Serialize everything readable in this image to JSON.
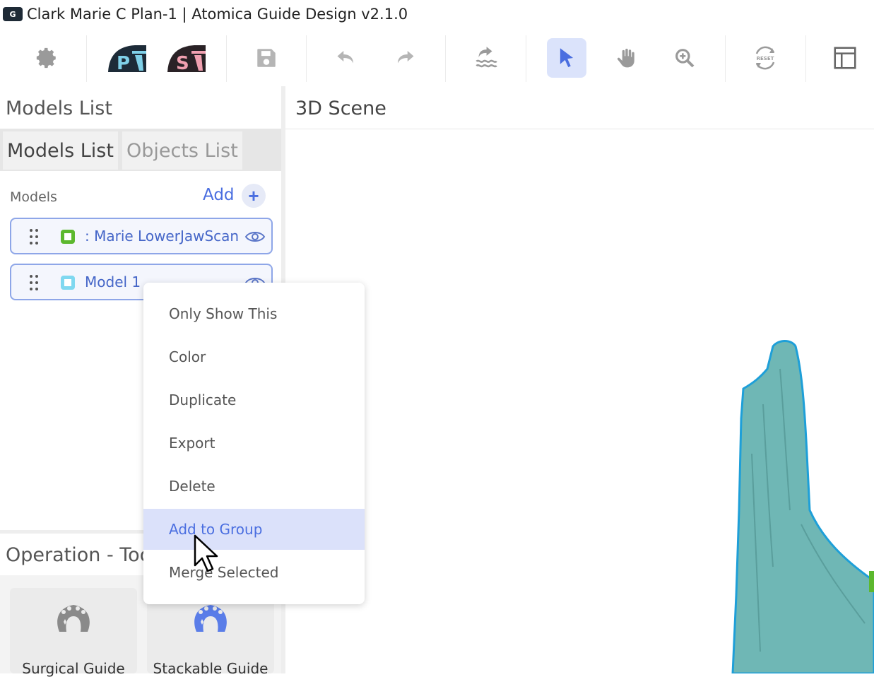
{
  "window": {
    "logo_text": "G",
    "title": "Clark Marie C Plan-1 | Atomica Guide Design v2.1.0"
  },
  "toolbar": {
    "buttons": [
      {
        "name": "settings",
        "icon": "gear-icon"
      },
      {
        "name": "p-logo",
        "icon": "p-logo-icon",
        "text": "P"
      },
      {
        "name": "s-logo",
        "icon": "s-logo-icon",
        "text": "S"
      },
      {
        "name": "save",
        "icon": "save-icon"
      },
      {
        "name": "undo",
        "icon": "undo-icon"
      },
      {
        "name": "redo",
        "icon": "redo-icon"
      },
      {
        "name": "smooth",
        "icon": "wave-arrow-icon"
      },
      {
        "name": "select",
        "icon": "pointer-icon",
        "active": true
      },
      {
        "name": "pan",
        "icon": "hand-icon"
      },
      {
        "name": "zoom",
        "icon": "zoom-icon"
      },
      {
        "name": "reset",
        "icon": "reset-icon",
        "text": "RESET"
      },
      {
        "name": "layout",
        "icon": "layout-icon"
      }
    ],
    "accent": "#4a6ee0"
  },
  "left_panel": {
    "header": "Models List",
    "tabs": [
      {
        "label": "Models List",
        "active": true
      },
      {
        "label": "Objects List",
        "active": false
      }
    ],
    "models_label": "Models",
    "add_label": "Add",
    "add_icon": "+",
    "models": [
      {
        "name": ": Marie LowerJawScan",
        "color": "#5cb82e",
        "visible": true
      },
      {
        "name": "Model 1",
        "color": "#7fd8f0",
        "visible": true
      }
    ],
    "operations_header": "Operation - Too",
    "operations": [
      {
        "label": "Surgical Guide",
        "icon": "guide-icon",
        "color": "#8a8a8a"
      },
      {
        "label": "Stackable Guide",
        "icon": "guide-icon",
        "color": "#4a6ee0"
      }
    ]
  },
  "scene": {
    "title": "3D Scene",
    "model_color": "#6fb7b5",
    "outline_color": "#1e9fd8"
  },
  "context_menu": {
    "items": [
      {
        "label": "Only Show This",
        "highlighted": false
      },
      {
        "label": "Color",
        "highlighted": false
      },
      {
        "label": "Duplicate",
        "highlighted": false
      },
      {
        "label": "Export",
        "highlighted": false
      },
      {
        "label": "Delete",
        "highlighted": false
      },
      {
        "label": "Add to Group",
        "highlighted": true
      },
      {
        "label": "Merge Selected",
        "highlighted": false
      }
    ]
  }
}
